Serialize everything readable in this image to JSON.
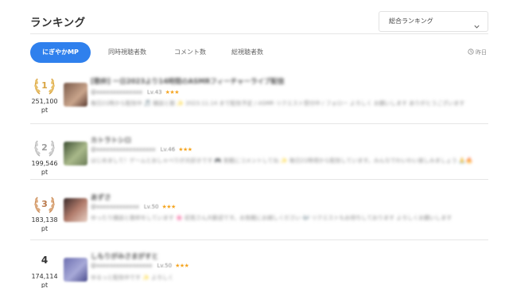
{
  "header": {
    "title": "ランキング"
  },
  "select": {
    "label": "総合ランキング"
  },
  "tabs": [
    "にぎやかMP",
    "同時視聴者数",
    "コメント数",
    "総視聴者数"
  ],
  "period": {
    "label": "昨日"
  },
  "colors": {
    "accent": "#2f80ed",
    "gold": "#d9a441",
    "silver": "#b6b6b6",
    "bronze": "#c98d5a",
    "star": "#f5a623"
  },
  "entries": [
    {
      "rank": "1",
      "points": "251,100",
      "unit": "pt",
      "name": "[歌枠] 一日2023より14時間のASMRフィーチャーライブ配信",
      "handle": "@xxxxxxxxxxxxxx",
      "level": "Lv.43",
      "stars": "★★★",
      "description": "毎日21時から配信中 🎵 雑談と歌 ✨ 2023.11.14 まで配信予定 / ASMR リクエスト受付中 / フォロー よろしく お願いします ありがとうございます"
    },
    {
      "rank": "2",
      "points": "199,546",
      "unit": "pt",
      "name": "カトラトシロ",
      "handle": "@xxxxxxxxxxxxxxxxxx",
      "level": "Lv.46",
      "stars": "★★★",
      "description": "はじめまして！ゲームとおしゃべりが大好きです 🎮 気軽にコメントしてね ✨ 毎日21時頃から配信しています。みんなでわいわい楽しみましょう 🙏🔥"
    },
    {
      "rank": "3",
      "points": "183,138",
      "unit": "pt",
      "name": "あずさ",
      "handle": "@xxxxxxxxxxxxx",
      "level": "Lv.50",
      "stars": "★★★",
      "description": "ゆったり雑談と歌枠をしています 🌸 初見さん大歓迎です。お気軽にお越しください 🎶 リクエストもお待ちしております よろしくお願いします"
    },
    {
      "rank": "4",
      "points": "174,114",
      "unit": "pt",
      "name": "しもりがみさまがすと",
      "handle": "@xxxxxxxxxxxxxxxxx",
      "level": "Lv.50",
      "stars": "★★★",
      "description": "ゆるっと配信中です ✨ よろしく"
    }
  ]
}
